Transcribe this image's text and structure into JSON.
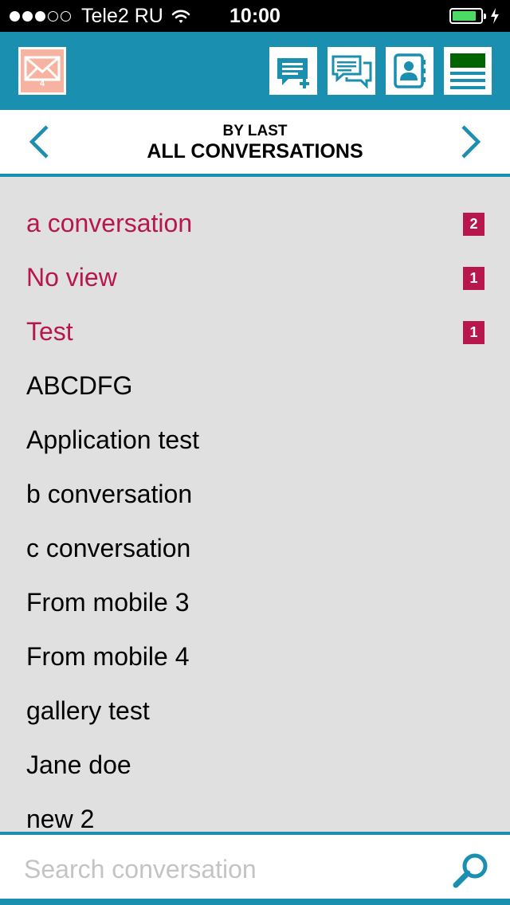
{
  "status_bar": {
    "carrier": "Tele2 RU",
    "time": "10:00",
    "signal_bars_filled": 3,
    "signal_bars_total": 5,
    "battery_level": 0.85
  },
  "header": {
    "mail_count": "4",
    "icons": [
      "mail-icon",
      "new-message-icon",
      "conversations-icon",
      "contacts-icon",
      "menu-icon"
    ],
    "accent_color": "#1a8fb0"
  },
  "nav": {
    "subtitle": "BY LAST",
    "title": "ALL CONVERSATIONS"
  },
  "conversations": [
    {
      "name": "a conversation",
      "unread": "2"
    },
    {
      "name": "No view",
      "unread": "1"
    },
    {
      "name": "Test",
      "unread": "1"
    },
    {
      "name": "ABCDFG",
      "unread": ""
    },
    {
      "name": "Application test",
      "unread": ""
    },
    {
      "name": "b conversation",
      "unread": ""
    },
    {
      "name": "c conversation",
      "unread": ""
    },
    {
      "name": "From mobile 3",
      "unread": ""
    },
    {
      "name": "From mobile 4",
      "unread": ""
    },
    {
      "name": "gallery test",
      "unread": ""
    },
    {
      "name": "Jane doe",
      "unread": ""
    },
    {
      "name": "new 2",
      "unread": ""
    }
  ],
  "colors": {
    "unread_text": "#b8174d",
    "badge_bg": "#b8174d",
    "list_bg": "#e0e0e0"
  },
  "search": {
    "placeholder": "Search conversation",
    "value": ""
  }
}
